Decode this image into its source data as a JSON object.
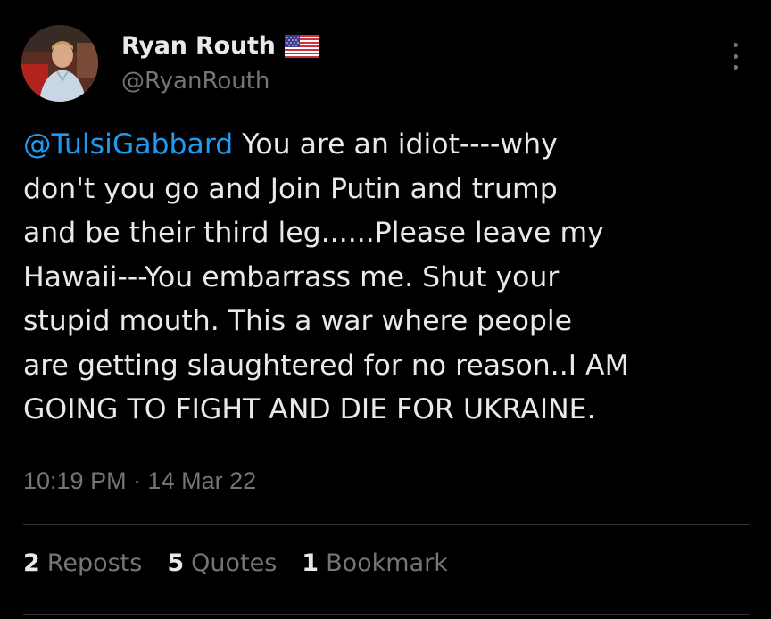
{
  "author": {
    "display_name": "Ryan Routh",
    "handle": "@RyanRouth",
    "verified_flag": "us-flag-icon"
  },
  "tweet": {
    "mention": "@TulsiGabbard",
    "body": " You are an idiot----why\ndon't you go and Join Putin and trump\nand be their third leg......Please leave my\nHawaii---You embarrass me.  Shut your\nstupid mouth.  This a war where people\nare getting slaughtered for no reason..I AM\nGOING TO FIGHT AND DIE FOR UKRAINE."
  },
  "timestamp": "10:19 PM · 14 Mar 22",
  "stats": {
    "reposts_count": "2",
    "reposts_label": "Reposts",
    "quotes_count": "5",
    "quotes_label": "Quotes",
    "bookmarks_count": "1",
    "bookmarks_label": "Bookmark"
  },
  "colors": {
    "background": "#000000",
    "text": "#e7e9ea",
    "secondary": "#71767b",
    "link": "#1d9bf0",
    "divider": "#2f3336"
  },
  "icons": {
    "more": "more-options-icon"
  }
}
